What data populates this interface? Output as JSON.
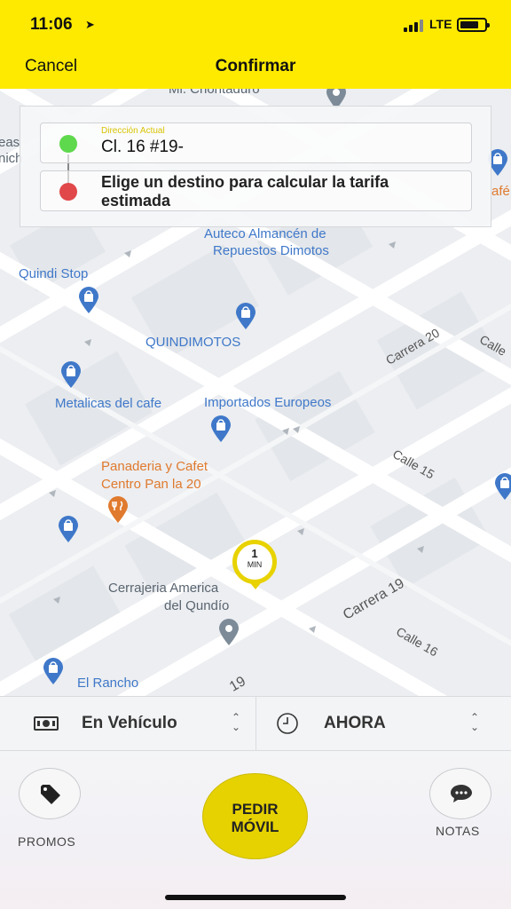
{
  "status_bar": {
    "time": "11:06",
    "network": "LTE"
  },
  "header": {
    "cancel_label": "Cancel",
    "title": "Confirmar"
  },
  "address": {
    "origin_caption": "Dirección Actual",
    "origin_value": "Cl. 16 #19-",
    "destination_placeholder": "Elige un destino para calcular la tarifa estimada"
  },
  "map": {
    "labels": {
      "top_partial": "Mi. Chontaduro",
      "left_partial_1": "eas",
      "left_partial_2": "nich",
      "right_partial": "afé",
      "auteco_1": "Auteco Almancén de",
      "auteco_2": "Repuestos Dimotos",
      "quindi_stop": "Quindi Stop",
      "quindimotos": "QUINDIMOTOS",
      "metalicas": "Metalicas del cafe",
      "importados": "Importados Europeos",
      "panaderia_1": "Panaderia y Cafet",
      "panaderia_2": "Centro Pan la 20",
      "cerrajeria_1": "Cerrajeria America",
      "cerrajeria_2": "del Qundío",
      "el_rancho": "El Rancho"
    },
    "streets": {
      "carrera_20": "Carrera 20",
      "calle_15": "Calle 15",
      "carrera_19": "Carrera 19",
      "calle_16": "Calle 16",
      "calle_right": "Calle",
      "bottom_19": "19"
    },
    "eta": {
      "value": "1",
      "unit": "MIN"
    }
  },
  "options": {
    "payment_label": "En Vehículo",
    "schedule_label": "AHORA"
  },
  "actions": {
    "promos_label": "PROMOS",
    "request_label_1": "PEDIR",
    "request_label_2": "MÓVIL",
    "notes_label": "NOTAS"
  },
  "colors": {
    "brand_yellow": "#fdea00",
    "button_yellow": "#e6d200",
    "poi_blue": "#3f78c9",
    "origin_green": "#5ed84c",
    "destination_red": "#e0484a"
  }
}
